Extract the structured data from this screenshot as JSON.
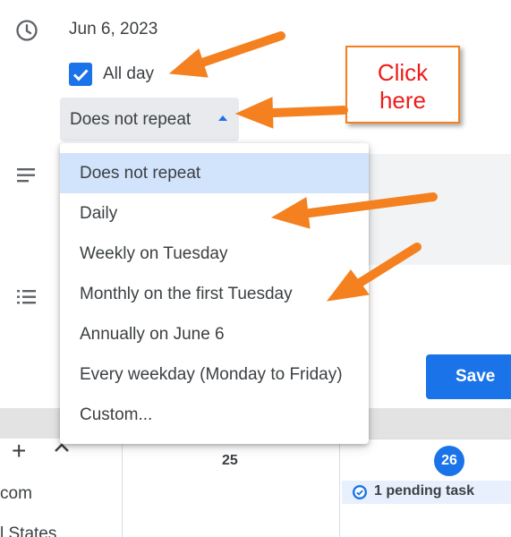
{
  "event": {
    "date": "Jun 6, 2023",
    "all_day_label": "All day",
    "all_day_checked": true,
    "repeat_value": "Does not repeat"
  },
  "repeat_menu": {
    "options": [
      "Does not repeat",
      "Daily",
      "Weekly on Tuesday",
      "Monthly on the first Tuesday",
      "Annually on June 6",
      "Every weekday (Monday to Friday)",
      "Custom..."
    ],
    "selected_index": 0
  },
  "actions": {
    "save_label": "Save"
  },
  "calendar": {
    "email_fragment": "com",
    "country_fragment": "l States",
    "day_25": "25",
    "day_26": "26",
    "task_label": "1 pending task"
  },
  "annotation": {
    "line1": "Click",
    "line2": "here"
  },
  "colors": {
    "accent": "#1a73e8",
    "selected_bg": "#d2e3fc",
    "annotation_orange": "#f4801f",
    "annotation_red": "#ee1c1c"
  }
}
